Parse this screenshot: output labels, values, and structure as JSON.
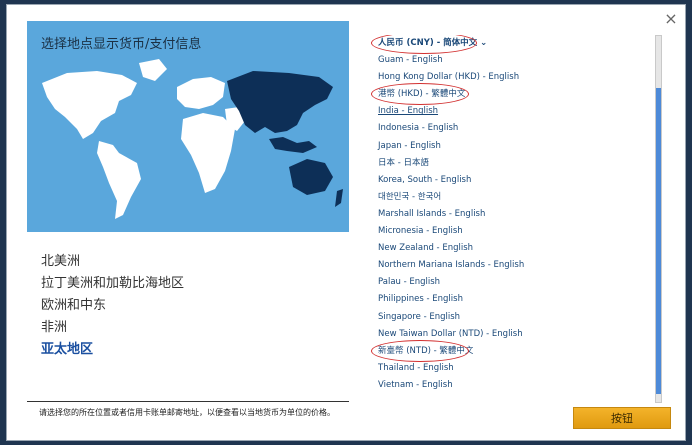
{
  "dialog": {
    "title": "选择地点显示货币/支付信息",
    "close_label": "×",
    "regions": [
      "北美洲",
      "拉丁美洲和加勒比海地区",
      "欧洲和中东",
      "非洲",
      "亚太地区"
    ],
    "active_region": "亚太地区",
    "footnote": "请选择您的所在位置或者信用卡账单邮寄地址，以便查看以当地货币为单位的价格。",
    "confirm_label": "按钮"
  },
  "countries": [
    "人民币 (CNY) - 简体中文",
    "Guam - English",
    "Hong Kong Dollar (HKD) - English",
    "港幣 (HKD) - 繁體中文",
    "India - English",
    "Indonesia - English",
    "Japan - English",
    "日本 - 日本語",
    "Korea, South - English",
    "대한민국 - 한국어",
    "Marshall Islands - English",
    "Micronesia - English",
    "New Zealand - English",
    "Northern Mariana Islands - English",
    "Palau - English",
    "Philippines - English",
    "Singapore - English",
    "New Taiwan Dollar (NTD) - English",
    "新臺幣 (NTD) - 繁體中文",
    "Thailand - English",
    "Vietnam - English"
  ],
  "selected_country": "人民币 (CNY) - 简体中文",
  "colors": {
    "map_background": "#5aa7dc",
    "land": "#ffffff",
    "highlighted_region": "#0d2f57",
    "link": "#1a4878",
    "annotation": "#d23030",
    "button": "#f0a91f"
  }
}
